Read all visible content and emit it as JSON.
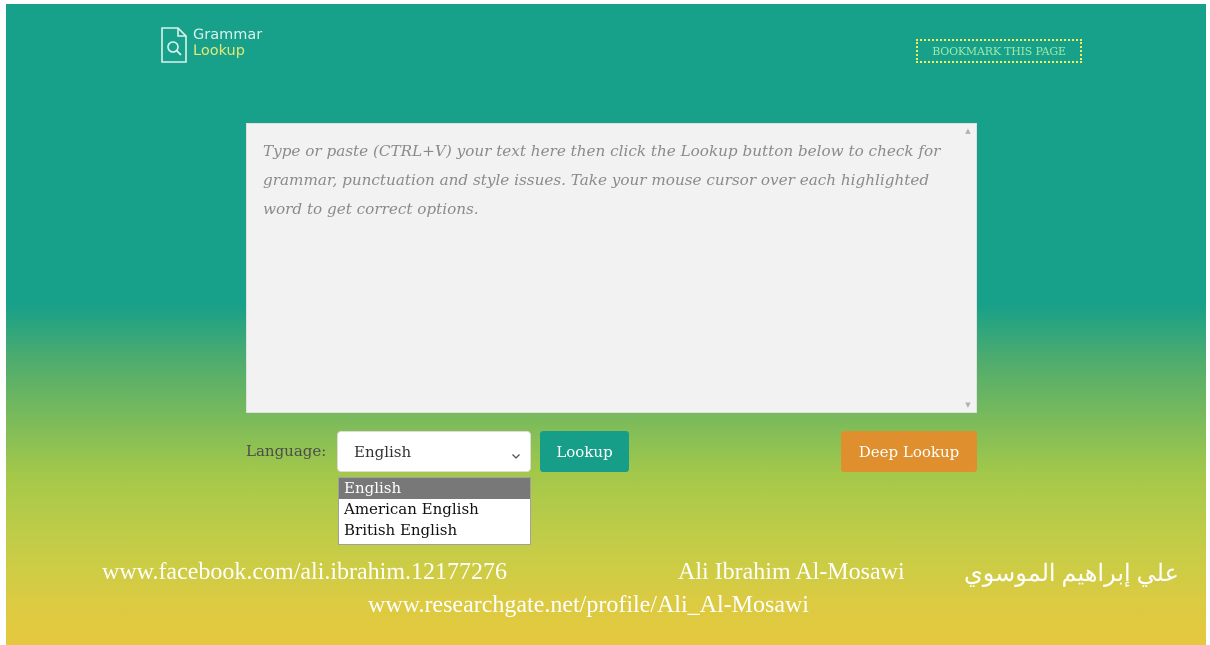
{
  "header": {
    "logo_line1": "Grammar",
    "logo_line2": "Lookup",
    "bookmark_label": "BOOKMARK THIS PAGE"
  },
  "editor": {
    "placeholder": "Type or paste (CTRL+V) your text here then click the Lookup button below to check for grammar, punctuation and style issues. Take your mouse cursor over each highlighted word to get correct options."
  },
  "controls": {
    "language_label": "Language:",
    "language_selected": "English",
    "lookup_label": "Lookup",
    "deep_lookup_label": "Deep Lookup"
  },
  "dropdown": {
    "options": [
      "English",
      "American English",
      "British English"
    ],
    "highlighted": "English"
  },
  "watermark": {
    "facebook": "www.facebook.com/ali.ibrahim.12177276",
    "name": "Ali Ibrahim Al-Mosawi",
    "arabic": "علي إبراهيم الموسوي",
    "researchgate": "www.researchgate.net/profile/Ali_Al-Mosawi"
  },
  "colors": {
    "brand_green": "#169e88",
    "deep_lookup_orange": "#df8f2e",
    "bookmark_yellow": "#f2ef5e"
  },
  "icons": {
    "logo": "document-search-icon",
    "select_arrow": "chevron-down-icon"
  }
}
